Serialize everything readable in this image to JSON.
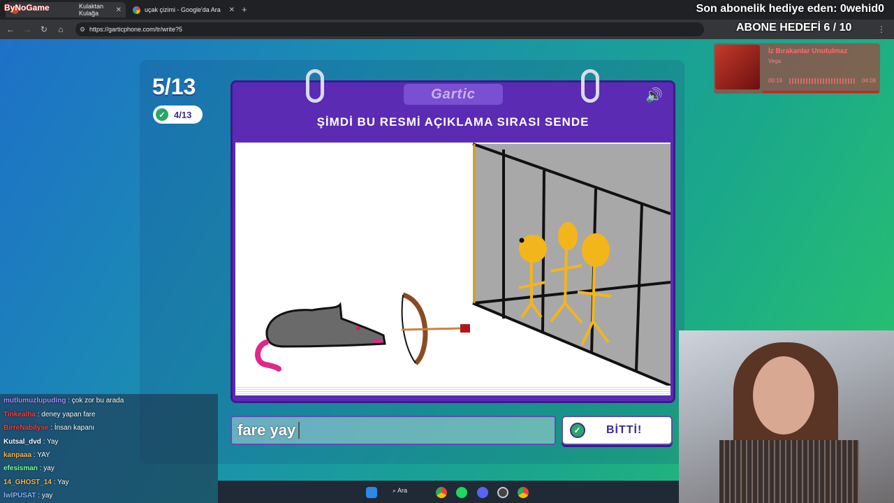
{
  "browser": {
    "tabs": [
      {
        "label": "Kulaktan Kulağa",
        "active": true
      },
      {
        "label": "uçak çizimi - Google'da Ara",
        "active": false
      }
    ],
    "url": "https://garticphone.com/tr/write?5"
  },
  "stream_overlay": {
    "brand": "ByNoGame",
    "sub_gift_text": "Son abonelik hediye eden: 0wehid0",
    "sub_goal_text": "ABONE HEDEFİ 6 / 10"
  },
  "game": {
    "round": "5/13",
    "done_count": "4/13",
    "logo": "Gartic",
    "prompt": "ŞİMDİ BU RESMİ AÇIKLAMA SIRASI SENDE",
    "answer_value": "fare yay",
    "done_button": "BİTTİ!"
  },
  "music": {
    "title": "İz Bırakanlar Unutulmaz",
    "artist": "Vega",
    "elapsed": "00:19",
    "total": "04:08"
  },
  "chat": [
    {
      "user": "mutlumuzlupuding",
      "text": "çok zor bu arada",
      "color": "#a78bfa"
    },
    {
      "user": "Tinkealha",
      "text": "deney yapan fare",
      "color": "#ff3b3b"
    },
    {
      "user": "BirreNabilyse",
      "text": "İnsan kapanı",
      "color": "#ff3b3b"
    },
    {
      "user": "Kutsal_dvd",
      "text": "Yay",
      "color": "#ffffff"
    },
    {
      "user": "kanpaaa",
      "text": "YAY",
      "color": "#ffb347"
    },
    {
      "user": "efesisman",
      "text": "yay",
      "color": "#7dff9a"
    },
    {
      "user": "14_GHOST_14",
      "text": "Yay",
      "color": "#ffb347"
    },
    {
      "user": "lwlPUSAT",
      "text": "yay",
      "color": "#8ab4ff"
    }
  ],
  "taskbar": {
    "search_label": "Ara"
  },
  "colors": {
    "board": "#5b2bb3",
    "accent_green": "#2ba66b"
  }
}
